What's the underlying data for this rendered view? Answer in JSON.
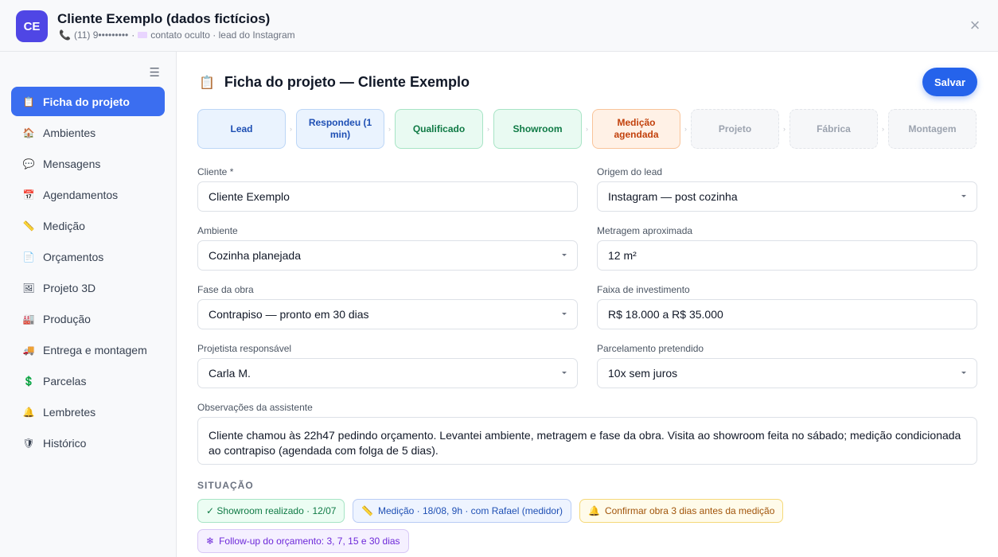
{
  "header": {
    "avatar": "CE",
    "title": "Cliente Exemplo (dados fictícios)",
    "phone": "(11) 9•••••••••",
    "contact": "contato oculto · lead do Instagram"
  },
  "sidebar": {
    "items": [
      {
        "label": "Ficha do projeto",
        "icon": "📋"
      },
      {
        "label": "Ambientes",
        "icon": "🏠"
      },
      {
        "label": "Mensagens",
        "icon": "💬"
      },
      {
        "label": "Agendamentos",
        "icon": "📅"
      },
      {
        "label": "Medição",
        "icon": "📏"
      },
      {
        "label": "Orçamentos",
        "icon": "📄"
      },
      {
        "label": "Projeto 3D",
        "icon": "🖼"
      },
      {
        "label": "Produção",
        "icon": "🏭"
      },
      {
        "label": "Entrega e montagem",
        "icon": "🚚"
      },
      {
        "label": "Parcelas",
        "icon": "💲"
      },
      {
        "label": "Lembretes",
        "icon": "🔔"
      },
      {
        "label": "Histórico",
        "icon": "🛡"
      }
    ]
  },
  "main": {
    "title": "Ficha do projeto — Cliente Exemplo",
    "save_label": "Salvar",
    "stages": [
      {
        "label": "Lead"
      },
      {
        "label": "Respondeu (1 min)"
      },
      {
        "label": "Qualificado"
      },
      {
        "label": "Showroom"
      },
      {
        "label": "Medição agendada"
      },
      {
        "label": "Projeto"
      },
      {
        "label": "Fábrica"
      },
      {
        "label": "Montagem"
      }
    ],
    "fields": {
      "cliente_label": "Cliente *",
      "cliente_value": "Cliente Exemplo",
      "origem_label": "Origem do lead",
      "origem_value": "Instagram — post cozinha",
      "ambiente_label": "Ambiente",
      "ambiente_value": "Cozinha planejada",
      "metragem_label": "Metragem aproximada",
      "metragem_value": "12 m²",
      "fase_label": "Fase da obra",
      "fase_value": "Contrapiso — pronto em 30 dias",
      "faixa_label": "Faixa de investimento",
      "faixa_value": "R$ 18.000 a R$ 35.000",
      "projetista_label": "Projetista responsável",
      "projetista_value": "Carla M.",
      "parcelamento_label": "Parcelamento pretendido",
      "parcelamento_value": "10x sem juros",
      "obs_label": "Observações da assistente",
      "obs_value": "Cliente chamou às 22h47 pedindo orçamento. Levantei ambiente, metragem e fase da obra. Visita ao showroom feita no sábado; medição condicionada ao contrapiso (agendada com folga de 5 dias)."
    },
    "situacao_title": "SITUAÇÃO",
    "chips": [
      {
        "text": "✓ Showroom realizado · 12/07"
      },
      {
        "icon": "📏",
        "text": "Medição · 18/08, 9h · com Rafael (medidor)"
      },
      {
        "icon": "🔔",
        "text": "Confirmar obra 3 dias antes da medição"
      },
      {
        "icon": "❄",
        "text": "Follow-up do orçamento: 3, 7, 15 e 30 dias"
      }
    ]
  }
}
